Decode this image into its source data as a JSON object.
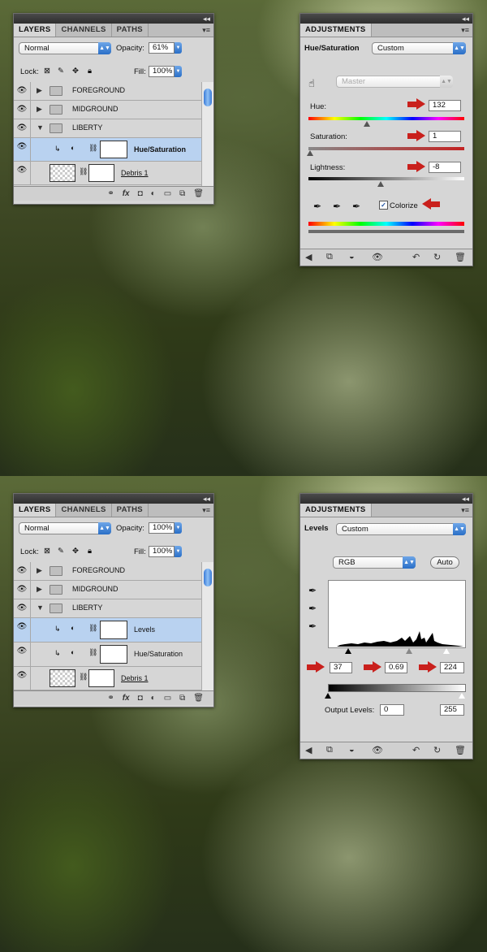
{
  "screen1": {
    "layers_panel": {
      "tabs": [
        "LAYERS",
        "CHANNELS",
        "PATHS"
      ],
      "blend_mode": "Normal",
      "opacity_label": "Opacity:",
      "opacity_value": "61%",
      "lock_label": "Lock:",
      "fill_label": "Fill:",
      "fill_value": "100%",
      "layers": [
        {
          "name": "FOREGROUND",
          "type": "group",
          "expanded": false
        },
        {
          "name": "MIDGROUND",
          "type": "group",
          "expanded": false
        },
        {
          "name": "LIBERTY",
          "type": "group",
          "expanded": true
        },
        {
          "name": "Hue/Saturation",
          "type": "adjustment",
          "selected": true
        },
        {
          "name": "Debris 1",
          "type": "layer"
        }
      ]
    },
    "adjustments_panel": {
      "tab": "ADJUSTMENTS",
      "title": "Hue/Saturation",
      "preset": "Custom",
      "channel": "Master",
      "hue_label": "Hue:",
      "hue_value": "132",
      "saturation_label": "Saturation:",
      "saturation_value": "1",
      "lightness_label": "Lightness:",
      "lightness_value": "-8",
      "colorize_label": "Colorize",
      "colorize_checked": true
    }
  },
  "screen2": {
    "layers_panel": {
      "tabs": [
        "LAYERS",
        "CHANNELS",
        "PATHS"
      ],
      "blend_mode": "Normal",
      "opacity_label": "Opacity:",
      "opacity_value": "100%",
      "lock_label": "Lock:",
      "fill_label": "Fill:",
      "fill_value": "100%",
      "layers": [
        {
          "name": "FOREGROUND",
          "type": "group",
          "expanded": false
        },
        {
          "name": "MIDGROUND",
          "type": "group",
          "expanded": false
        },
        {
          "name": "LIBERTY",
          "type": "group",
          "expanded": true
        },
        {
          "name": "Levels",
          "type": "adjustment",
          "selected": true
        },
        {
          "name": "Hue/Saturation",
          "type": "adjustment"
        },
        {
          "name": "Debris 1",
          "type": "layer"
        }
      ]
    },
    "adjustments_panel": {
      "tab": "ADJUSTMENTS",
      "title": "Levels",
      "preset": "Custom",
      "channel": "RGB",
      "auto_label": "Auto",
      "input_black": "37",
      "input_gamma": "0.69",
      "input_white": "224",
      "output_label": "Output Levels:",
      "output_black": "0",
      "output_white": "255"
    }
  },
  "colors": {
    "panel_bg": "#d6d6d6",
    "selection": "#b9d2f0",
    "accent_blue": "#2a6fc7",
    "annotation_red": "#c9201c"
  }
}
